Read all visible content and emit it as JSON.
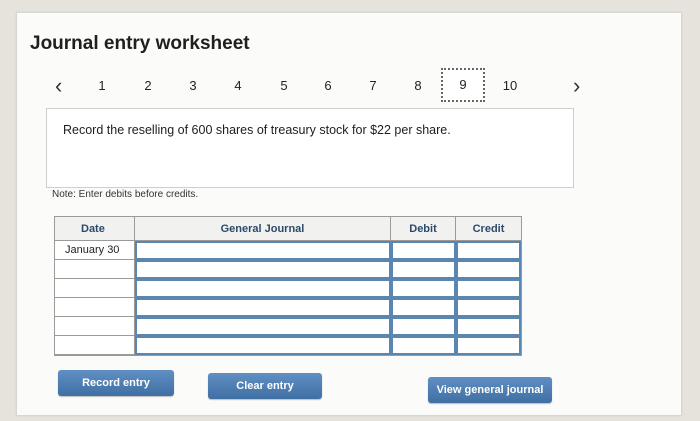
{
  "worksheet": {
    "title": "Journal entry worksheet",
    "nav": {
      "prev_icon": "chevron-left-icon",
      "next_icon": "chevron-right-icon",
      "pages": [
        "1",
        "2",
        "3",
        "4",
        "5",
        "6",
        "7",
        "8",
        "9",
        "10"
      ],
      "active_page": "9"
    },
    "instruction": "Record the reselling of 600 shares of treasury stock for $22 per share.",
    "note": "Note: Enter debits before credits.",
    "table": {
      "headers": {
        "date": "Date",
        "general_journal": "General Journal",
        "debit": "Debit",
        "credit": "Credit"
      },
      "rows": [
        {
          "date": "January 30",
          "account": "",
          "debit": "",
          "credit": ""
        },
        {
          "date": "",
          "account": "",
          "debit": "",
          "credit": ""
        },
        {
          "date": "",
          "account": "",
          "debit": "",
          "credit": ""
        },
        {
          "date": "",
          "account": "",
          "debit": "",
          "credit": ""
        },
        {
          "date": "",
          "account": "",
          "debit": "",
          "credit": ""
        },
        {
          "date": "",
          "account": "",
          "debit": "",
          "credit": ""
        }
      ]
    },
    "buttons": {
      "record": "Record entry",
      "clear": "Clear entry",
      "view": "View general journal"
    },
    "colors": {
      "button": "#4a7bb0",
      "header_text": "#2b4a6b",
      "input_border": "#5b86b0"
    }
  }
}
